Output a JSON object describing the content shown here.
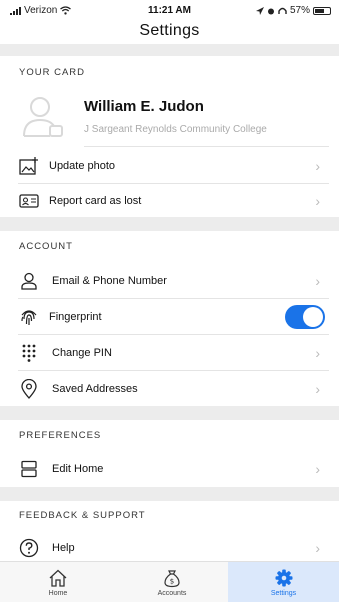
{
  "status_bar": {
    "carrier": "Verizon",
    "time": "11:21 AM",
    "battery": "57%"
  },
  "nav": {
    "title": "Settings"
  },
  "your_card": {
    "header": "YOUR CARD",
    "name": "William E. Judon",
    "school": "J Sargeant Reynolds Community College",
    "update_photo": "Update photo",
    "report_lost": "Report card as lost"
  },
  "account": {
    "header": "ACCOUNT",
    "email_phone": "Email & Phone Number",
    "fingerprint": "Fingerprint",
    "fingerprint_enabled": true,
    "change_pin": "Change PIN",
    "saved_addresses": "Saved Addresses"
  },
  "preferences": {
    "header": "PREFERENCES",
    "edit_home": "Edit Home"
  },
  "feedback": {
    "header": "FEEDBACK & SUPPORT",
    "help": "Help"
  },
  "tab_bar": {
    "tabs": [
      {
        "label": "Home",
        "icon": "home-icon"
      },
      {
        "label": "Accounts",
        "icon": "money-bag-icon"
      },
      {
        "label": "Settings",
        "icon": "gear-icon"
      }
    ],
    "active": "Settings",
    "accent": "#1a73e8"
  }
}
